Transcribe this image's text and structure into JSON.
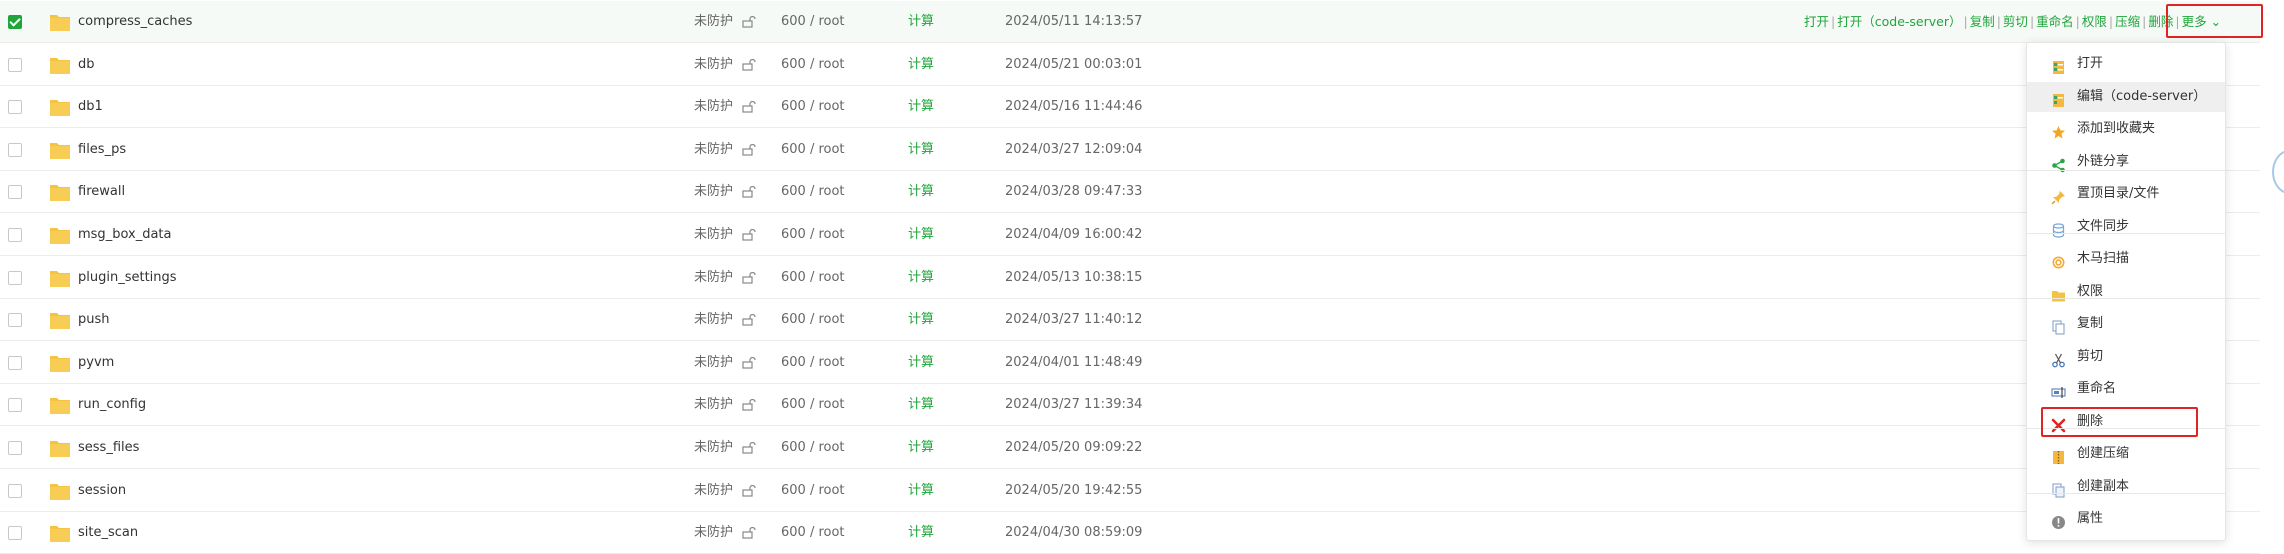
{
  "rows": [
    {
      "name": "compress_caches",
      "protect": "未防护",
      "perm": "600 / root",
      "calc": "计算",
      "time": "2024/05/11 14:13:57",
      "selected": true
    },
    {
      "name": "db",
      "protect": "未防护",
      "perm": "600 / root",
      "calc": "计算",
      "time": "2024/05/21 00:03:01"
    },
    {
      "name": "db1",
      "protect": "未防护",
      "perm": "600 / root",
      "calc": "计算",
      "time": "2024/05/16 11:44:46"
    },
    {
      "name": "files_ps",
      "protect": "未防护",
      "perm": "600 / root",
      "calc": "计算",
      "time": "2024/03/27 12:09:04"
    },
    {
      "name": "firewall",
      "protect": "未防护",
      "perm": "600 / root",
      "calc": "计算",
      "time": "2024/03/28 09:47:33"
    },
    {
      "name": "msg_box_data",
      "protect": "未防护",
      "perm": "600 / root",
      "calc": "计算",
      "time": "2024/04/09 16:00:42"
    },
    {
      "name": "plugin_settings",
      "protect": "未防护",
      "perm": "600 / root",
      "calc": "计算",
      "time": "2024/05/13 10:38:15"
    },
    {
      "name": "push",
      "protect": "未防护",
      "perm": "600 / root",
      "calc": "计算",
      "time": "2024/03/27 11:40:12"
    },
    {
      "name": "pyvm",
      "protect": "未防护",
      "perm": "600 / root",
      "calc": "计算",
      "time": "2024/04/01 11:48:49"
    },
    {
      "name": "run_config",
      "protect": "未防护",
      "perm": "600 / root",
      "calc": "计算",
      "time": "2024/03/27 11:39:34"
    },
    {
      "name": "sess_files",
      "protect": "未防护",
      "perm": "600 / root",
      "calc": "计算",
      "time": "2024/05/20 09:09:22"
    },
    {
      "name": "session",
      "protect": "未防护",
      "perm": "600 / root",
      "calc": "计算",
      "time": "2024/05/20 19:42:55"
    },
    {
      "name": "site_scan",
      "protect": "未防护",
      "perm": "600 / root",
      "calc": "计算",
      "time": "2024/04/30 08:59:09"
    }
  ],
  "row_ops": {
    "open": "打开",
    "open_code_server": "打开（code-server）",
    "copy": "复制",
    "cut": "剪切",
    "rename": "重命名",
    "permission": "权限",
    "compress": "压缩",
    "delete": "删除",
    "more": "更多"
  },
  "context_menu": {
    "items": [
      {
        "label": "打开",
        "icon": "open-file-icon"
      },
      {
        "label": "编辑（code-server）",
        "icon": "edit-file-icon"
      },
      {
        "label": "添加到收藏夹",
        "icon": "star-icon"
      },
      {
        "label": "外链分享",
        "icon": "share-icon"
      },
      {
        "label": "置顶目录/文件",
        "icon": "pin-icon"
      },
      {
        "label": "文件同步",
        "icon": "database-icon"
      },
      {
        "label": "木马扫描",
        "icon": "scan-icon"
      },
      {
        "label": "权限",
        "icon": "folder-icon"
      },
      {
        "label": "复制",
        "icon": "copy-icon"
      },
      {
        "label": "剪切",
        "icon": "scissors-icon"
      },
      {
        "label": "重命名",
        "icon": "rename-icon"
      },
      {
        "label": "删除",
        "icon": "delete-icon"
      },
      {
        "label": "创建压缩",
        "icon": "zip-icon"
      },
      {
        "label": "创建副本",
        "icon": "duplicate-icon"
      },
      {
        "label": "属性",
        "icon": "info-icon"
      }
    ]
  },
  "colors": {
    "accent": "#20a53a",
    "highlight": "#e02424",
    "folder": "#f5c342"
  }
}
